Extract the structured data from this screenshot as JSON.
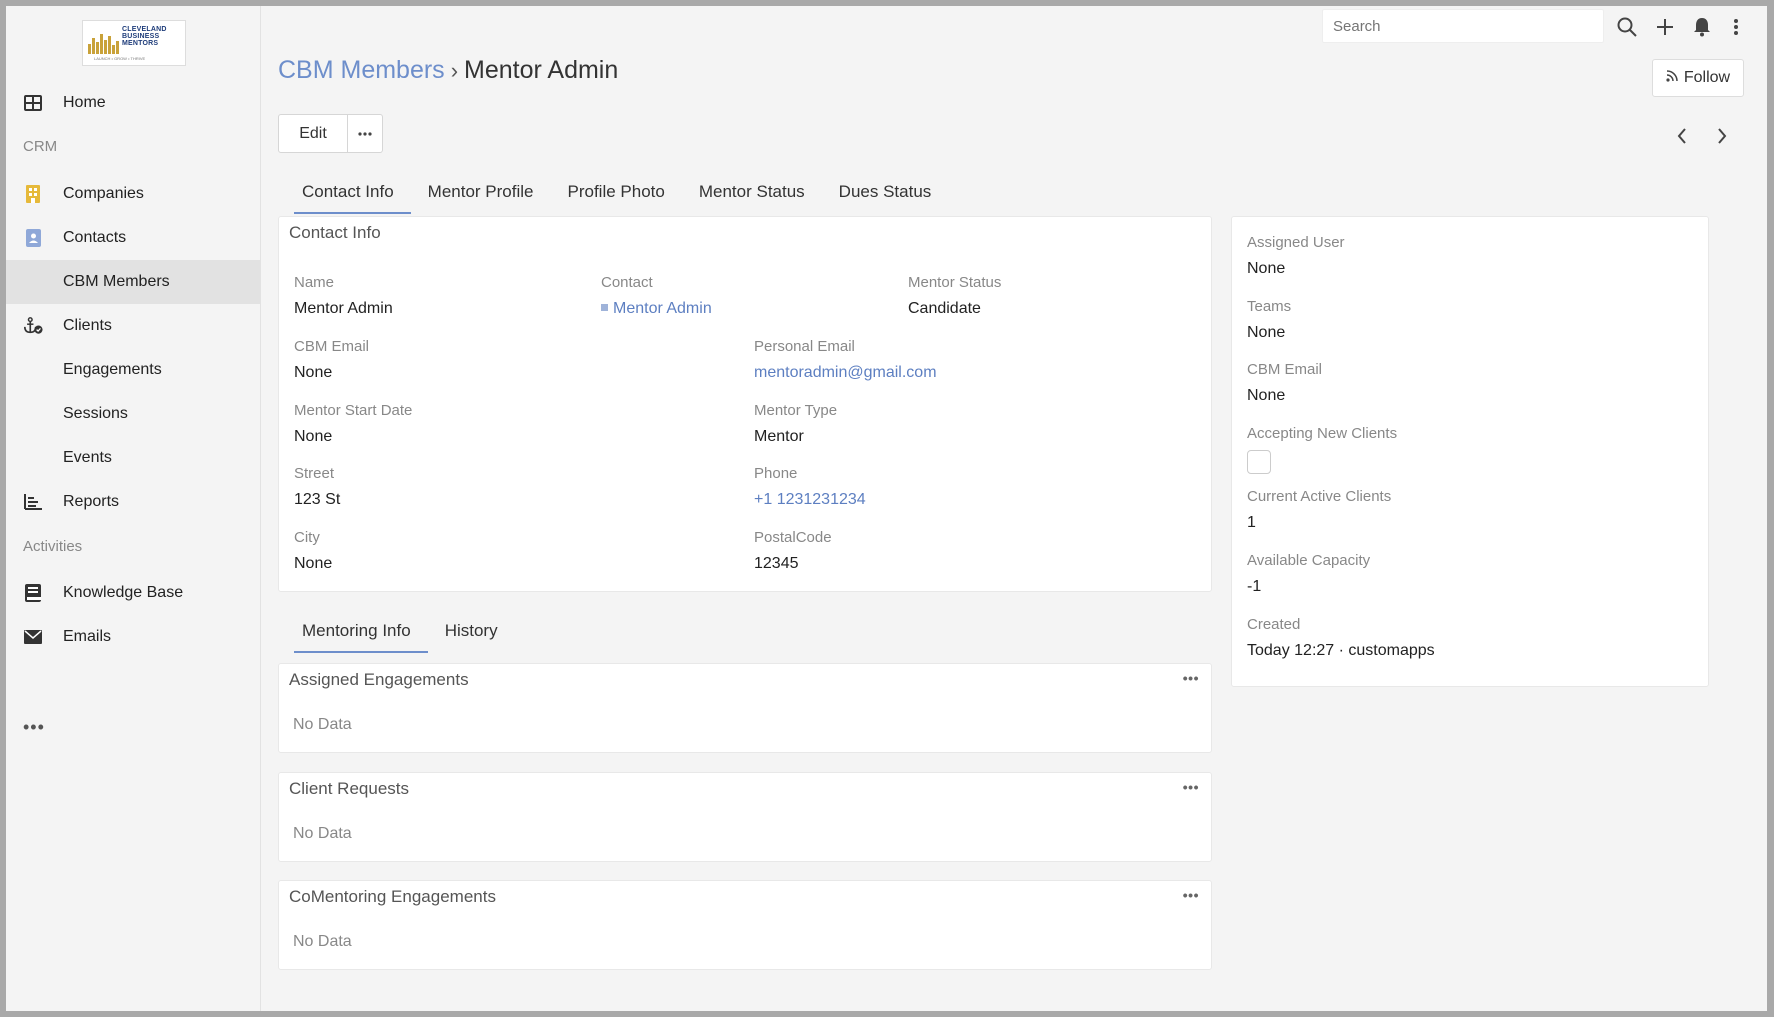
{
  "sidebar": {
    "logo_text": [
      "CLEVELAND",
      "BUSINESS",
      "MENTORS"
    ],
    "logo_sub": "LAUNCH • GROW • THRIVE",
    "items": [
      {
        "label": "Home",
        "icon": "grid-icon"
      },
      {
        "section": "CRM"
      },
      {
        "label": "Companies",
        "icon": "building-icon"
      },
      {
        "label": "Contacts",
        "icon": "contact-card-icon"
      },
      {
        "label": "CBM Members",
        "icon": ""
      },
      {
        "label": "Clients",
        "icon": "anchor-check-icon"
      },
      {
        "label": "Engagements",
        "icon": ""
      },
      {
        "label": "Sessions",
        "icon": ""
      },
      {
        "label": "Events",
        "icon": ""
      },
      {
        "label": "Reports",
        "icon": "bar-chart-icon"
      },
      {
        "section": "Activities"
      },
      {
        "label": "Knowledge Base",
        "icon": "book-icon"
      },
      {
        "label": "Emails",
        "icon": "envelope-icon"
      }
    ],
    "more": "•••"
  },
  "topbar": {
    "search_placeholder": "Search"
  },
  "header": {
    "crumb_parent": "CBM Members",
    "crumb_sep": "›",
    "crumb_current": "Mentor Admin",
    "follow_label": "Follow",
    "edit_label": "Edit"
  },
  "tabs_top": [
    "Contact Info",
    "Mentor Profile",
    "Profile Photo",
    "Mentor Status",
    "Dues Status"
  ],
  "contact_panel": {
    "title": "Contact Info",
    "fields": [
      {
        "label": "Name",
        "value": "Mentor Admin"
      },
      {
        "label": "Contact",
        "value": "Mentor Admin"
      },
      {
        "label": "Mentor Status",
        "value": "Candidate"
      },
      {
        "label": "CBM Email",
        "value": "None"
      },
      {
        "label": "Personal Email",
        "value": "mentoradmin@gmail.com"
      },
      {
        "label": "Mentor Start Date",
        "value": "None"
      },
      {
        "label": "Mentor Type",
        "value": "Mentor"
      },
      {
        "label": "Street",
        "value": "123 St"
      },
      {
        "label": "Phone",
        "value": "+1 1231231234"
      },
      {
        "label": "City",
        "value": "None"
      },
      {
        "label": "PostalCode",
        "value": "12345"
      }
    ]
  },
  "tabs_bottom": [
    "Mentoring Info",
    "History"
  ],
  "related_panels": [
    {
      "title": "Assigned Engagements",
      "empty": "No Data"
    },
    {
      "title": "Client Requests",
      "empty": "No Data"
    },
    {
      "title": "CoMentoring Engagements",
      "empty": "No Data"
    }
  ],
  "side_panel": {
    "fields": [
      {
        "label": "Assigned User",
        "value": "None"
      },
      {
        "label": "Teams",
        "value": "None"
      },
      {
        "label": "CBM Email",
        "value": "None"
      },
      {
        "label": "Accepting New Clients",
        "value": ""
      },
      {
        "label": "Current Active Clients",
        "value": "1"
      },
      {
        "label": "Available Capacity",
        "value": "-1"
      },
      {
        "label": "Created",
        "value": "Today 12:27 · customapps"
      }
    ]
  },
  "colors": {
    "accent": "#6d8ecb",
    "link": "#5d7fc1",
    "sidebar_active": "#e2e2e2",
    "building_icon": "#e6b93a",
    "contact_icon": "#8fa8d8"
  }
}
